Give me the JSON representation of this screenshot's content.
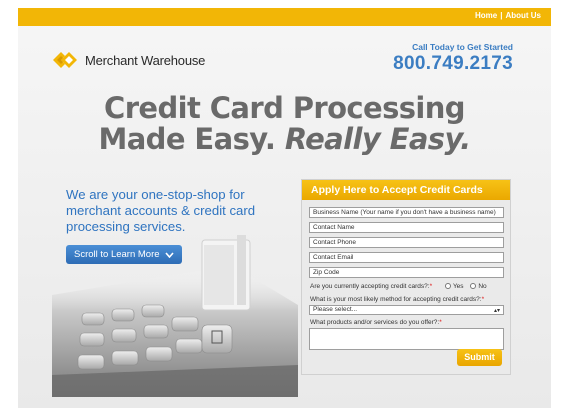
{
  "topbar": {
    "home_label": "Home",
    "separator": "|",
    "about_label": "About Us"
  },
  "brand": {
    "name": "Merchant Warehouse",
    "logo_icon": "merchant-warehouse-logo-icon"
  },
  "call": {
    "label": "Call Today to Get Started",
    "phone": "800.749.2173"
  },
  "headline": {
    "line1": "Credit Card Processing",
    "line2_a": "Made Easy.",
    "line2_b": "Really Easy."
  },
  "hero": {
    "text": "We are your one-stop-shop for merchant accounts & credit card processing services.",
    "scroll_button_label": "Scroll to Learn More"
  },
  "form": {
    "title": "Apply Here to Accept Credit Cards",
    "business_name_value": "Business Name (Your name if you don't have a business name)",
    "contact_name_value": "Contact Name",
    "contact_phone_value": "Contact Phone",
    "contact_email_value": "Contact Email",
    "zip_value": "Zip Code",
    "q1_label": "Are you currently accepting credit cards?:",
    "q1_req": "*",
    "yes_label": "Yes",
    "no_label": "No",
    "q2_label": "What is your most likely method for accepting credit cards?:",
    "q2_req": "*",
    "q2_selected": "Please select...",
    "q3_label": "What products and/or services do you offer?:",
    "q3_req": "*",
    "submit_label": "Submit"
  },
  "colors": {
    "brand_yellow": "#f2b606",
    "brand_blue": "#3b7dc2",
    "headline_gray": "#6a6a6a"
  }
}
